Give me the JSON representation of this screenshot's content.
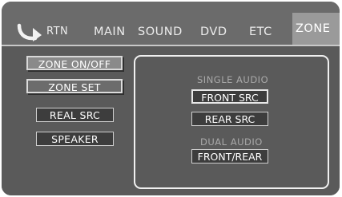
{
  "header": {
    "return": {
      "label": "RTN",
      "icon": "return-arrow-icon"
    },
    "tabs": [
      {
        "label": "MAIN"
      },
      {
        "label": "SOUND"
      },
      {
        "label": "DVD"
      },
      {
        "label": "ETC"
      },
      {
        "label": "ZONE",
        "active": true
      }
    ]
  },
  "sidebar": {
    "items": [
      {
        "label": "ZONE ON/OFF"
      },
      {
        "label": "ZONE SET"
      },
      {
        "label": "REAL SRC"
      },
      {
        "label": "SPEAKER"
      }
    ]
  },
  "panel": {
    "single_audio": {
      "title": "SINGLE AUDIO",
      "options": [
        "FRONT SRC",
        "REAR SRC"
      ]
    },
    "dual_audio": {
      "title": "DUAL AUDIO",
      "options": [
        "FRONT/REAR"
      ]
    }
  },
  "colors": {
    "background": "#5a5a5a",
    "header": "#6b6b6b",
    "active_tab": "#9a9a9a",
    "button": "#3d3d3d",
    "text": "#ffffff",
    "section_label": "#a9a9a9"
  }
}
